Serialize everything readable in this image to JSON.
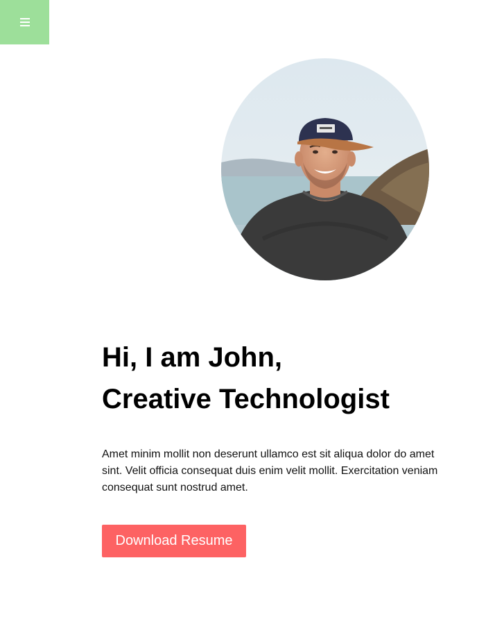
{
  "menu": {
    "icon": "hamburger-menu-icon",
    "background_color": "#9ddf9a"
  },
  "hero": {
    "title_line1": "Hi, I am John,",
    "title_line2": "Creative Technologist",
    "description": "Amet minim mollit non deserunt ullamco est sit aliqua dolor do amet sint. Velit officia consequat duis enim velit mollit. Exercitation veniam consequat sunt nostrud amet.",
    "button_label": "Download Resume",
    "button_color": "#fd6263"
  }
}
